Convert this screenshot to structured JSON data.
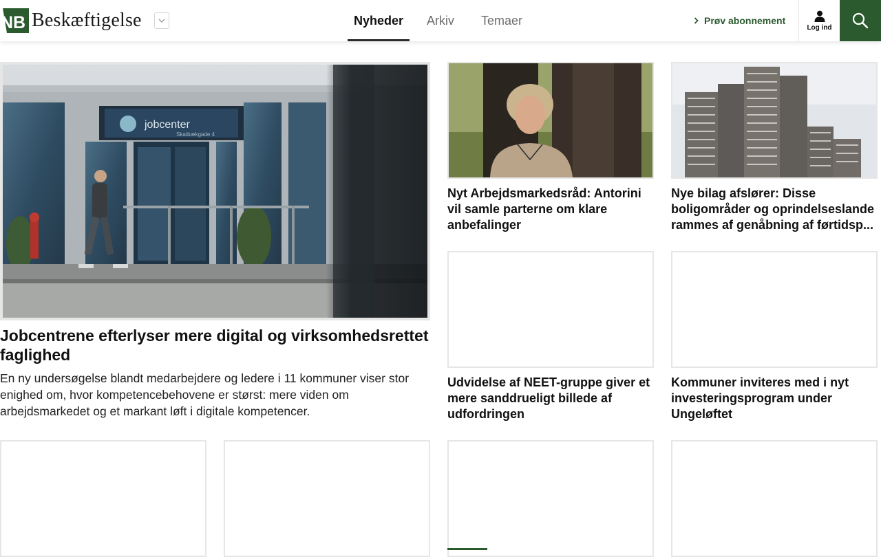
{
  "header": {
    "logo_text": "Beskæftigelse",
    "logo_initials": "NB",
    "nav": [
      {
        "label": "Nyheder",
        "active": true
      },
      {
        "label": "Arkiv",
        "active": false
      },
      {
        "label": "Temaer",
        "active": false
      }
    ],
    "trial_label": "Prøv abonnement",
    "login_label": "Log ind"
  },
  "featured": {
    "headline": "Jobcentrene efterlyser mere digital og virksomhedsrettet faglighed",
    "lede": "En ny undersøgelse blandt medarbejdere og ledere i 11 kommuner viser stor enighed om, hvor kompetencebehovene er størst: mere viden om arbejdsmarkedet og et markant løft i digitale kompetencer.",
    "image_sign_text": "jobcenter",
    "image_sign_subtext": "Skatbækgade 4"
  },
  "articles": [
    {
      "headline": "Nyt Arbejdsmarkedsråd: Antorini vil samle parterne om klare anbefalinger"
    },
    {
      "headline": "Nye bilag afslører: Disse boligområder og oprindelseslande rammes af genåbning af førtidsp..."
    },
    {
      "headline": "Udvidelse af NEET-gruppe giver et mere sanddrueligt billede af udfordringen"
    },
    {
      "headline": "Kommuner inviteres med i nyt investeringsprogram under Ungeløftet"
    }
  ],
  "colors": {
    "brand_green": "#2a5a2e",
    "text": "#111111",
    "muted_nav": "#6c6c6c",
    "image_border": "#e6e6e6"
  },
  "icons": [
    "chevron-down-icon",
    "chevron-right-icon",
    "user-icon",
    "search-icon"
  ]
}
